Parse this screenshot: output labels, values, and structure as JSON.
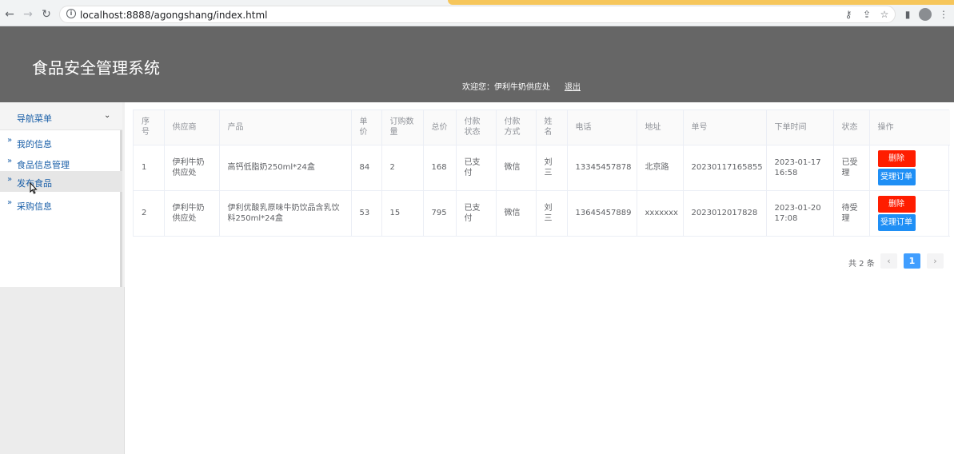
{
  "browser": {
    "url": "localhost:8888/agongshang/index.html",
    "back_icon": "arrow-left-icon",
    "forward_icon": "arrow-right-icon",
    "reload_icon": "reload-icon"
  },
  "header": {
    "title": "食品安全管理系统",
    "welcome": "欢迎您：伊利牛奶供应处",
    "logout": "退出",
    "bg_color": "#666666"
  },
  "sidebar": {
    "menu_title": "导航菜单",
    "items": [
      {
        "label": "我的信息"
      },
      {
        "label": "食品信息管理"
      },
      {
        "label": "发布食品"
      },
      {
        "label": "采购信息"
      }
    ]
  },
  "table": {
    "headers": [
      "序号",
      "供应商",
      "产品",
      "单价",
      "订购数量",
      "总价",
      "付款状态",
      "付款方式",
      "姓名",
      "电话",
      "地址",
      "单号",
      "下单时间",
      "状态",
      "操作"
    ],
    "rows": [
      {
        "index": "1",
        "supplier": "伊利牛奶供应处",
        "product": "高钙低脂奶250ml*24盒",
        "price": "84",
        "qty": "2",
        "total": "168",
        "pay_status": "已支付",
        "pay_method": "微信",
        "name": "刘三",
        "phone": "13345457878",
        "address": "北京路",
        "order_no": "20230117165855",
        "time": "2023-01-17 16:58",
        "status": "已受理",
        "delete_label": "删除",
        "accept_label": "受理订单"
      },
      {
        "index": "2",
        "supplier": "伊利牛奶供应处",
        "product": "伊利优酸乳原味牛奶饮品含乳饮料250ml*24盒",
        "price": "53",
        "qty": "15",
        "total": "795",
        "pay_status": "已支付",
        "pay_method": "微信",
        "name": "刘三",
        "phone": "13645457889",
        "address": "xxxxxxx",
        "order_no": "2023012017828",
        "time": "2023-01-20 17:08",
        "status": "待受理",
        "delete_label": "删除",
        "accept_label": "受理订单"
      }
    ],
    "delete_color": "#ff1d00",
    "accept_color": "#1f8ff5"
  },
  "pagination": {
    "total": "共 2 条",
    "current": "1",
    "prev": "‹",
    "next": "›"
  }
}
